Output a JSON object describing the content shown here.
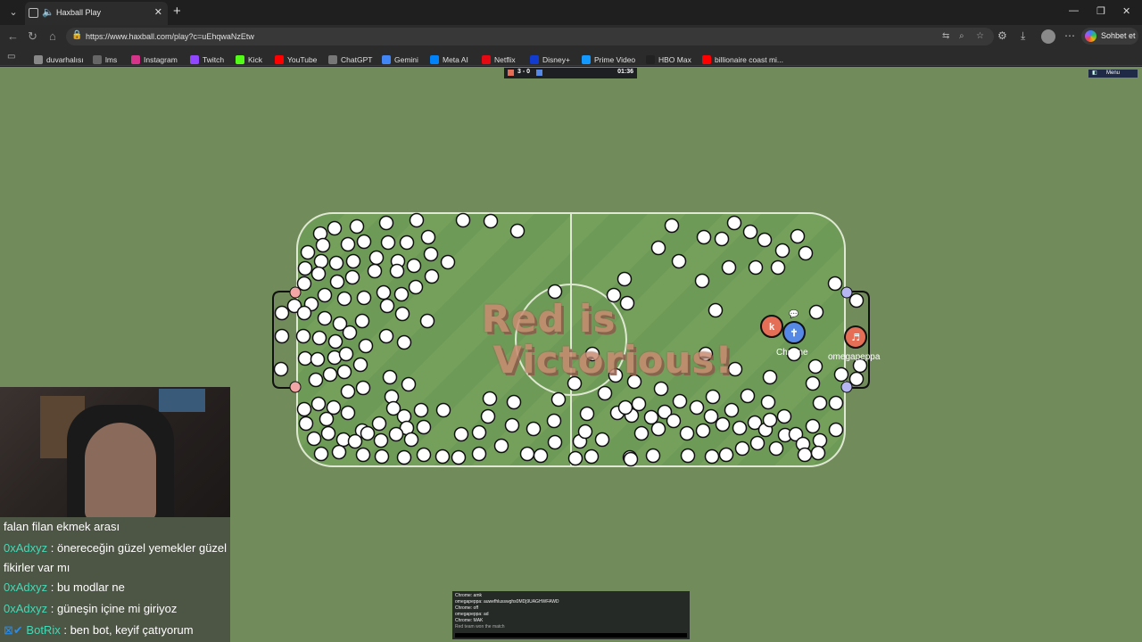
{
  "browser": {
    "tab_title": "Haxball Play",
    "url": "https://www.haxball.com/play?c=uEhqwaNzEtw",
    "copilot_label": "Sohbet et",
    "bookmarks": [
      {
        "label": "duvarhalısı",
        "icon_color": "#888888"
      },
      {
        "label": "lms",
        "icon_color": "#666666"
      },
      {
        "label": "Instagram",
        "icon_color": "#d6338a"
      },
      {
        "label": "Twitch",
        "icon_color": "#9146ff"
      },
      {
        "label": "Kick",
        "icon_color": "#53fc18"
      },
      {
        "label": "YouTube",
        "icon_color": "#ff0000"
      },
      {
        "label": "ChatGPT",
        "icon_color": "#777777"
      },
      {
        "label": "Gemini",
        "icon_color": "#4285f4"
      },
      {
        "label": "Meta AI",
        "icon_color": "#0082fb"
      },
      {
        "label": "Netflix",
        "icon_color": "#e50914"
      },
      {
        "label": "Disney+",
        "icon_color": "#113ccf"
      },
      {
        "label": "Prime Video",
        "icon_color": "#1399ff"
      },
      {
        "label": "HBO Max",
        "icon_color": "#222222"
      },
      {
        "label": "billionaire coast mi...",
        "icon_color": "#ff0000"
      }
    ]
  },
  "game": {
    "score": "3 - 0",
    "timer": "01:36",
    "menu_label": "Menu",
    "victory_line1": "Red is",
    "victory_line2": "Victorious!",
    "players": [
      {
        "name": "Chrome",
        "team": "blue",
        "avatar": "✝"
      },
      {
        "name": "omegapeppa",
        "team": "red",
        "avatar": "♬"
      },
      {
        "name": "",
        "team": "red",
        "avatar": "k"
      }
    ],
    "colors": {
      "red": "#e56e56",
      "blue": "#5689e5",
      "field": "#718c5a"
    }
  },
  "stream_chat": [
    {
      "user": "",
      "message": "falan filan ekmek arası"
    },
    {
      "user": "0xAdxyz",
      "message": ": önereceğin güzel yemekler güzel fikirler var mı"
    },
    {
      "user": "0xAdxyz",
      "message": ": bu modlar ne"
    },
    {
      "user": "0xAdxyz",
      "message": ": güneşin içine mi giriyoz"
    },
    {
      "user": "BotRix",
      "message": ": ben bot, keyif çatıyorum"
    }
  ],
  "game_chat": [
    "Chrome: amk",
    "omegapeppa: auwefhlusswghs0MDj9UAGHWFAWD",
    "Chrome: off",
    "omegapeppa: ad",
    "Chrome: MAK",
    "Red team won the match"
  ]
}
